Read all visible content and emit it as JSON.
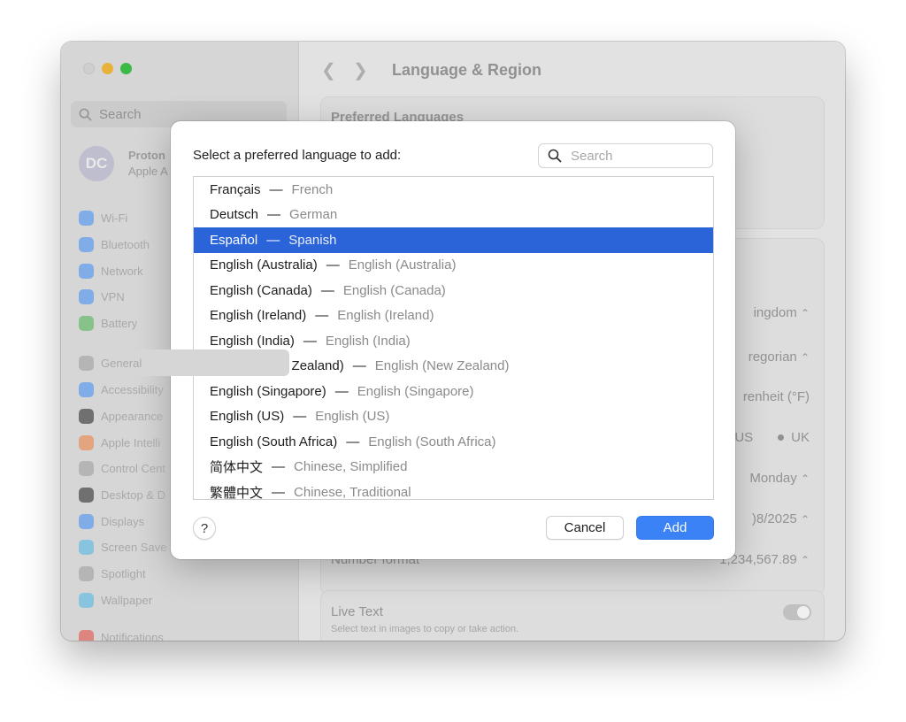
{
  "window": {
    "title": "Language & Region",
    "back_glyph": "❮",
    "forward_glyph": "❯"
  },
  "sidebar": {
    "search_placeholder": "Search",
    "account": {
      "initials": "DC",
      "name": "Proton",
      "subtitle": "Apple A"
    },
    "items": [
      {
        "label": "Wi-Fi",
        "color": "#3b8cf5"
      },
      {
        "label": "Bluetooth",
        "color": "#3b8cf5"
      },
      {
        "label": "Network",
        "color": "#3b8cf5"
      },
      {
        "label": "VPN",
        "color": "#3b8cf5"
      },
      {
        "label": "Battery",
        "color": "#49b24e"
      },
      {
        "label": "General",
        "color": "#9a9a9a"
      },
      {
        "label": "Accessibility",
        "color": "#3b8cf5"
      },
      {
        "label": "Appearance",
        "color": "#1d1d1f"
      },
      {
        "label": "Apple Intelli",
        "color": "#ef7b3a"
      },
      {
        "label": "Control Cent",
        "color": "#9a9a9a"
      },
      {
        "label": "Desktop & D",
        "color": "#1d1d1f"
      },
      {
        "label": "Displays",
        "color": "#3b8cf5"
      },
      {
        "label": "Screen Save",
        "color": "#4bb7e8"
      },
      {
        "label": "Spotlight",
        "color": "#9a9a9a"
      },
      {
        "label": "Wallpaper",
        "color": "#4bb7e8"
      },
      {
        "label": "Notifications",
        "color": "#e8443a"
      }
    ]
  },
  "content": {
    "preferred_languages_title": "Preferred Languages",
    "region_value": "ingdom",
    "calendar_value": "regorian",
    "temperature_value": "renheit (°F)",
    "measurement_us": "US",
    "measurement_uk": "UK",
    "first_day_value": "Monday",
    "date_format_value": ")8/2025",
    "number_format_label": "Number format",
    "number_format_value": "1,234,567.89",
    "stepper_glyph": "⌃⌄",
    "live_text_title": "Live Text",
    "live_text_desc": "Select text in images to copy or take action."
  },
  "dialog": {
    "prompt": "Select a preferred language to add:",
    "search_placeholder": "Search",
    "selected_index": 2,
    "languages": [
      {
        "native": "Français",
        "english": "French"
      },
      {
        "native": "Deutsch",
        "english": "German"
      },
      {
        "native": "Español",
        "english": "Spanish"
      },
      {
        "native": "English (Australia)",
        "english": "English (Australia)"
      },
      {
        "native": "English (Canada)",
        "english": "English (Canada)"
      },
      {
        "native": "English (Ireland)",
        "english": "English (Ireland)"
      },
      {
        "native": "English (India)",
        "english": "English (India)"
      },
      {
        "native": "English (New Zealand)",
        "english": "English (New Zealand)"
      },
      {
        "native": "English (Singapore)",
        "english": "English (Singapore)"
      },
      {
        "native": "English (US)",
        "english": "English (US)"
      },
      {
        "native": "English (South Africa)",
        "english": "English (South Africa)"
      },
      {
        "native": "简体中文",
        "english": "Chinese, Simplified"
      },
      {
        "native": "繁體中文",
        "english": "Chinese, Traditional"
      }
    ],
    "separator": "—",
    "help_label": "?",
    "cancel_label": "Cancel",
    "add_label": "Add"
  }
}
